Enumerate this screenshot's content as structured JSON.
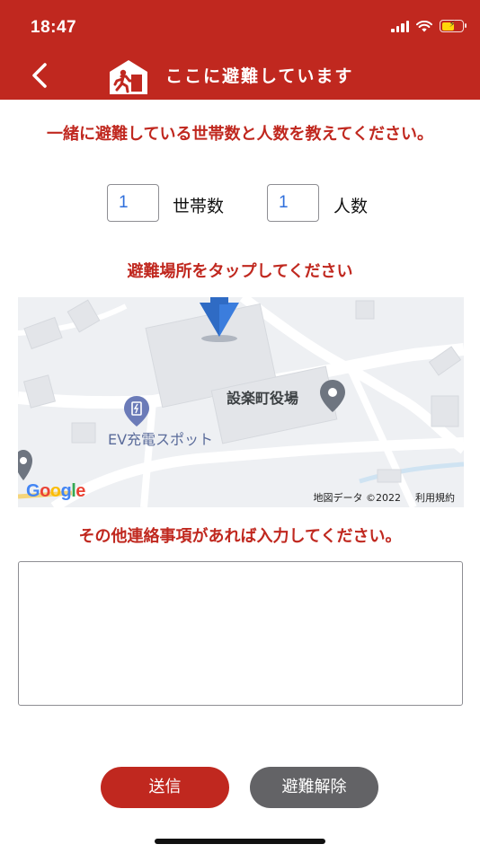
{
  "status_bar": {
    "time": "18:47"
  },
  "header": {
    "title": "ここに避難しています"
  },
  "form": {
    "count_prompt": "一緒に避難している世帯数と人数を教えてください。",
    "households_value": "1",
    "households_label": "世帯数",
    "people_value": "1",
    "people_label": "人数",
    "map_prompt": "避難場所をタップしてください",
    "notes_prompt": "その他連絡事項があれば入力してください。",
    "notes_value": ""
  },
  "map": {
    "place_label": "設楽町役場",
    "ev_label": "EV充電スポット",
    "logo_text": "Google",
    "attribution": "地図データ ©2022",
    "terms": "利用規約"
  },
  "buttons": {
    "send": "送信",
    "cancel": "避難解除"
  },
  "colors": {
    "brand_red": "#c0281f",
    "cancel_gray": "#636366",
    "value_blue": "#2f6fdc"
  }
}
